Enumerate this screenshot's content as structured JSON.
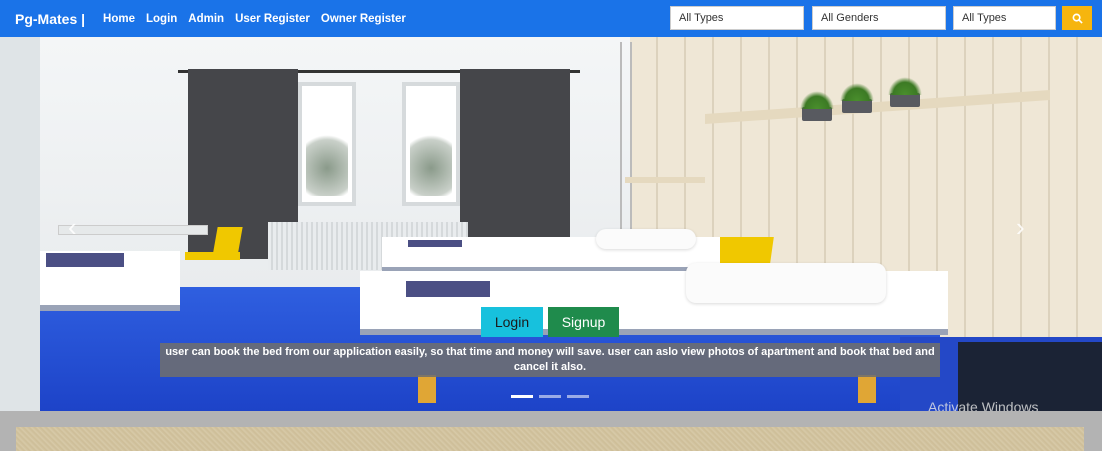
{
  "navbar": {
    "brand": "Pg-Mates |",
    "links": [
      "Home",
      "Login",
      "Admin",
      "User Register",
      "Owner Register"
    ],
    "filters": {
      "type1": "All Types",
      "gender": "All Genders",
      "type2": "All Types"
    },
    "search_icon": "search-icon",
    "colors": {
      "background": "#1a73e8",
      "search_button": "#f6b50e"
    }
  },
  "carousel": {
    "login_label": "Login",
    "signup_label": "Signup",
    "caption": "user can book the bed from our application easily, so that time and money will save. user can aslo view photos of apartment and book that bed and cancel it also.",
    "prev_glyph": "‹",
    "next_glyph": "›",
    "slide_count": 3,
    "active_slide": 1,
    "colors": {
      "login": "#17c1dd",
      "signup": "#1f8b4c"
    }
  },
  "watermark": "Activate Windows"
}
